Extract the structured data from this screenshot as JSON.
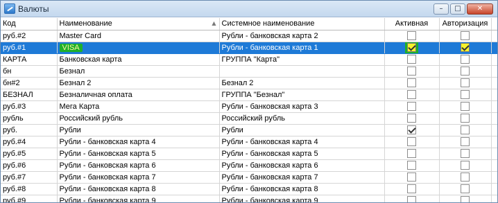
{
  "window": {
    "title": "Валюты",
    "minimize_glyph": "–",
    "maximize_glyph": "□",
    "close_glyph": "✕"
  },
  "table": {
    "columns": {
      "code": "Код",
      "name": "Наименование",
      "system_name": "Системное наименование",
      "active": "Активная",
      "authorization": "Авторизация"
    },
    "sort_arrow": "▲",
    "rows": [
      {
        "code": "руб.#2",
        "name": "Master Card",
        "system_name": "Рубли - банковская карта 2",
        "active": false,
        "authorization": false
      },
      {
        "code": "руб.#1",
        "name": "VISA",
        "system_name": "Рубли - банковская карта 1",
        "active": true,
        "authorization": true,
        "selected": true
      },
      {
        "code": "КАРТА",
        "name": "Банковская карта",
        "system_name": "ГРУППА \"Карта\"",
        "active": false,
        "authorization": false
      },
      {
        "code": "бн",
        "name": "Безнал",
        "system_name": "",
        "active": false,
        "authorization": false
      },
      {
        "code": "бн#2",
        "name": "Безнал 2",
        "system_name": "Безнал 2",
        "active": false,
        "authorization": false
      },
      {
        "code": "БЕЗНАЛ",
        "name": "Безналичная оплата",
        "system_name": "ГРУППА \"Безнал\"",
        "active": false,
        "authorization": false
      },
      {
        "code": "руб.#3",
        "name": "Мега Карта",
        "system_name": "Рубли - банковская карта 3",
        "active": false,
        "authorization": false
      },
      {
        "code": "рубль",
        "name": "Российский рубль",
        "system_name": "Российский рубль",
        "active": false,
        "authorization": false
      },
      {
        "code": "руб.",
        "name": "Рубли",
        "system_name": "Рубли",
        "active": true,
        "authorization": false
      },
      {
        "code": "руб.#4",
        "name": "Рубли - банковская карта 4",
        "system_name": "Рубли - банковская карта 4",
        "active": false,
        "authorization": false
      },
      {
        "code": "руб.#5",
        "name": "Рубли - банковская карта 5",
        "system_name": "Рубли - банковская карта 5",
        "active": false,
        "authorization": false
      },
      {
        "code": "руб.#6",
        "name": "Рубли - банковская карта 6",
        "system_name": "Рубли - банковская карта 6",
        "active": false,
        "authorization": false
      },
      {
        "code": "руб.#7",
        "name": "Рубли - банковская карта 7",
        "system_name": "Рубли - банковская карта 7",
        "active": false,
        "authorization": false
      },
      {
        "code": "руб.#8",
        "name": "Рубли - банковская карта 8",
        "system_name": "Рубли - банковская карта 8",
        "active": false,
        "authorization": false
      },
      {
        "code": "руб.#9",
        "name": "Рубли - банковская карта 9",
        "system_name": "Рубли - банковская карта 9",
        "active": false,
        "authorization": false
      }
    ]
  },
  "colors": {
    "selection": "#1e7ad7",
    "highlight_marker": "#1fb02a",
    "highlight_checkbox": "#f7f32b"
  }
}
